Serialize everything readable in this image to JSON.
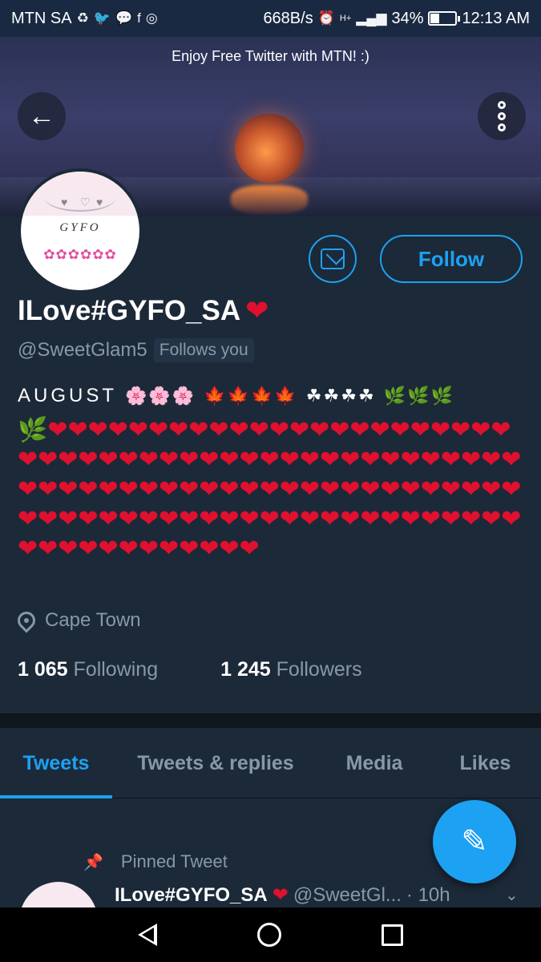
{
  "status_bar": {
    "carrier": "MTN SA",
    "net_speed": "668B/s",
    "network_badge": "H+",
    "battery": "34%",
    "battery_level": 0.34,
    "time": "12:13 AM"
  },
  "banner": {
    "promo": "Enjoy Free Twitter with MTN! :)"
  },
  "avatar_art": {
    "caption": "GYFO",
    "flowers": "✿✿✿✿✿✿"
  },
  "profile": {
    "name": "ILove#GYFO_SA",
    "name_emoji": "❤",
    "handle": "@SweetGlam5",
    "follows_you": "Follows you",
    "follow_label": "Follow",
    "bio_word": "AUGUST",
    "bio_emoji": {
      "flowers": "🌸🌸🌸",
      "leaves": "🍁🍁🍁🍁",
      "clovers": "☘☘☘☘",
      "herbs": "🌿🌿🌿"
    },
    "bio_hearts": "🌿❤❤❤❤❤❤❤❤❤❤❤❤❤❤❤❤❤❤❤❤❤❤❤❤❤❤❤❤❤❤❤❤❤❤❤❤❤❤❤❤❤❤❤❤❤❤❤❤❤❤❤❤❤❤❤❤❤❤❤❤❤❤❤❤❤❤❤❤❤❤❤❤❤❤❤❤❤❤❤❤❤❤❤❤❤❤❤❤❤❤❤❤❤❤❤❤❤❤❤❤❤❤❤❤❤❤❤❤❤❤",
    "location": "Cape Town",
    "following_count": "1 065",
    "following_label": "Following",
    "followers_count": "1 245",
    "followers_label": "Followers"
  },
  "tabs": [
    {
      "label": "Tweets",
      "active": true
    },
    {
      "label": "Tweets & replies",
      "active": false
    },
    {
      "label": "Media",
      "active": false
    },
    {
      "label": "Likes",
      "active": false
    }
  ],
  "pinned_tweet": {
    "label": "Pinned Tweet",
    "name": "ILove#GYFO_SA",
    "name_emoji": "❤",
    "handle": "@SweetGl...",
    "time": "· 10h"
  },
  "colors": {
    "accent": "#1da1f2",
    "background": "#1c2938",
    "muted": "#8899a6",
    "heart": "#e0102f"
  }
}
